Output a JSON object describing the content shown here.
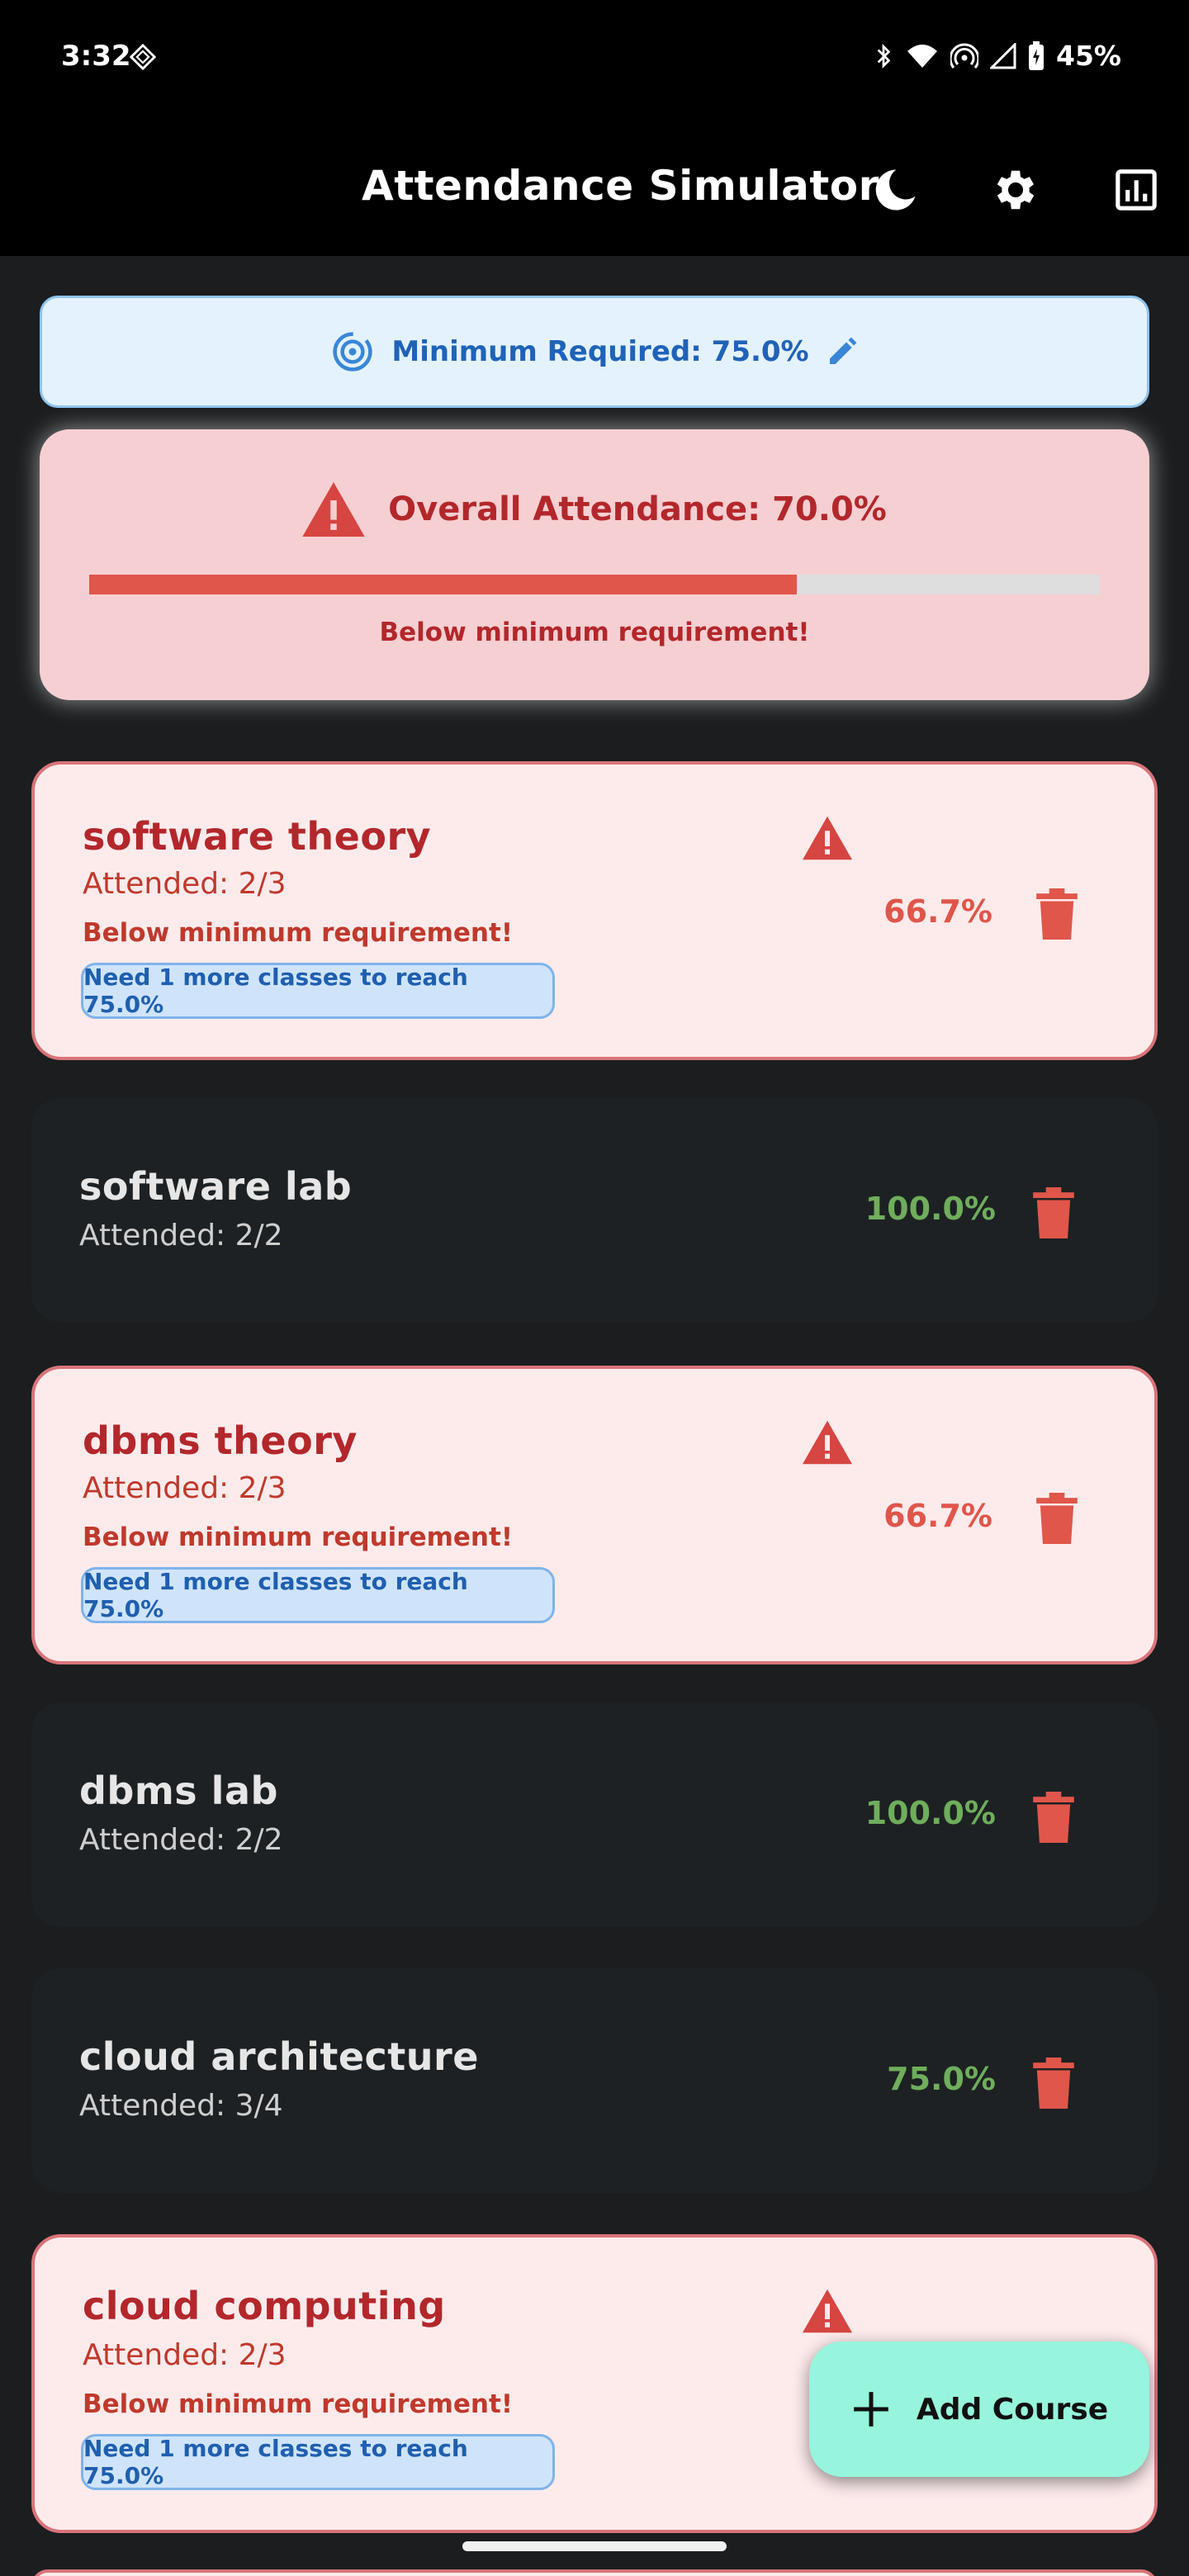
{
  "status_bar": {
    "time": "3:32",
    "battery": "45%",
    "icons": [
      "vpn-diamond-icon",
      "bluetooth-icon",
      "wifi-icon",
      "hotspot-icon",
      "signal-icon",
      "battery-icon"
    ]
  },
  "app_bar": {
    "title": "Attendance Simulator",
    "actions": [
      "dark-mode-moon-icon",
      "settings-gear-icon",
      "stats-chart-icon"
    ]
  },
  "minimum": {
    "label": "Minimum Required: 75.0%",
    "icon": "target-icon",
    "edit_icon": "edit-pencil-icon"
  },
  "overall": {
    "title": "Overall Attendance: 70.0%",
    "percent": 70.0,
    "status": "Below minimum requirement!"
  },
  "colors": {
    "warn_card_bg": "#fdebec",
    "warn_text": "#b3272b",
    "ok_card_bg": "#1d2123",
    "ok_percent": "#6fae5c",
    "danger": "#e0564a",
    "fab_bg": "#96f5dc",
    "banner_bg": "#e4f2fd"
  },
  "courses": [
    {
      "name": "software theory",
      "attended": "Attended: 2/3",
      "percent": "66.7%",
      "below": "Below minimum requirement!",
      "need": "Need 1 more classes to reach 75.0%"
    },
    {
      "name": "software lab",
      "attended": "Attended: 2/2",
      "percent": "100.0%"
    },
    {
      "name": "dbms theory",
      "attended": "Attended: 2/3",
      "percent": "66.7%",
      "below": "Below minimum requirement!",
      "need": "Need 1 more classes to reach 75.0%"
    },
    {
      "name": "dbms lab",
      "attended": "Attended: 2/2",
      "percent": "100.0%"
    },
    {
      "name": "cloud architecture",
      "attended": "Attended: 3/4",
      "percent": "75.0%"
    },
    {
      "name": "cloud computing",
      "attended": "Attended: 2/3",
      "below": "Below minimum requirement!",
      "need": "Need 1 more classes to reach 75.0%"
    }
  ],
  "fab": {
    "label": "Add Course",
    "icon": "plus-icon"
  }
}
